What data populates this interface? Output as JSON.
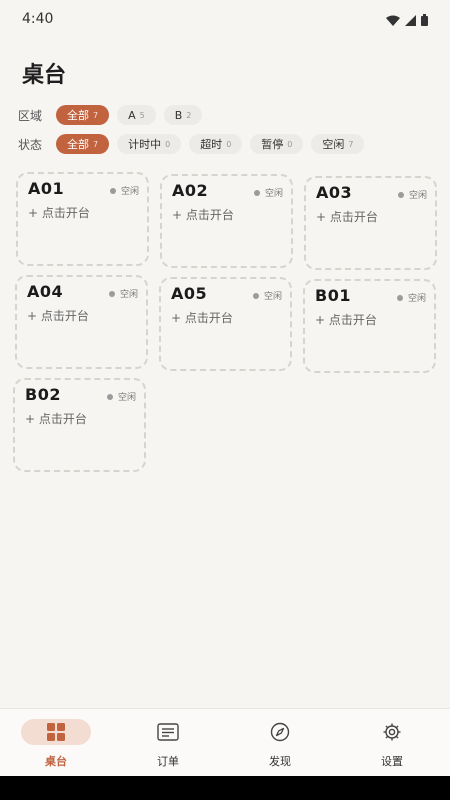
{
  "status_bar": {
    "time": "4:40",
    "icons": [
      "wifi-icon",
      "signal-icon",
      "battery-icon"
    ]
  },
  "page": {
    "title": "桌台"
  },
  "filters": {
    "area": {
      "label": "区域",
      "chips": [
        {
          "label": "全部",
          "count": "7",
          "active": true
        },
        {
          "label": "A",
          "count": "5",
          "active": false
        },
        {
          "label": "B",
          "count": "2",
          "active": false
        }
      ]
    },
    "status": {
      "label": "状态",
      "chips": [
        {
          "label": "全部",
          "count": "7",
          "active": true
        },
        {
          "label": "计时中",
          "count": "0",
          "active": false
        },
        {
          "label": "超时",
          "count": "0",
          "active": false
        },
        {
          "label": "暂停",
          "count": "0",
          "active": false
        },
        {
          "label": "空闲",
          "count": "7",
          "active": false
        }
      ]
    }
  },
  "tables": [
    {
      "name": "A01",
      "status": "空闲",
      "action": "+ 点击开台"
    },
    {
      "name": "A02",
      "status": "空闲",
      "action": "+ 点击开台"
    },
    {
      "name": "A03",
      "status": "空闲",
      "action": "+ 点击开台"
    },
    {
      "name": "A04",
      "status": "空闲",
      "action": "+ 点击开台"
    },
    {
      "name": "A05",
      "status": "空闲",
      "action": "+ 点击开台"
    },
    {
      "name": "B01",
      "status": "空闲",
      "action": "+ 点击开台"
    },
    {
      "name": "B02",
      "status": "空闲",
      "action": "+ 点击开台"
    }
  ],
  "tabbar": {
    "tabs": [
      {
        "label": "桌台",
        "icon": "grid-icon",
        "active": true
      },
      {
        "label": "订单",
        "icon": "receipt-icon",
        "active": false
      },
      {
        "label": "发现",
        "icon": "compass-icon",
        "active": false
      },
      {
        "label": "设置",
        "icon": "gear-icon",
        "active": false
      }
    ]
  },
  "colors": {
    "accent": "#c1633f",
    "background": "#f6f5f2",
    "chip": "#ecebe7",
    "active_tab_bg": "#f3ddd2"
  }
}
